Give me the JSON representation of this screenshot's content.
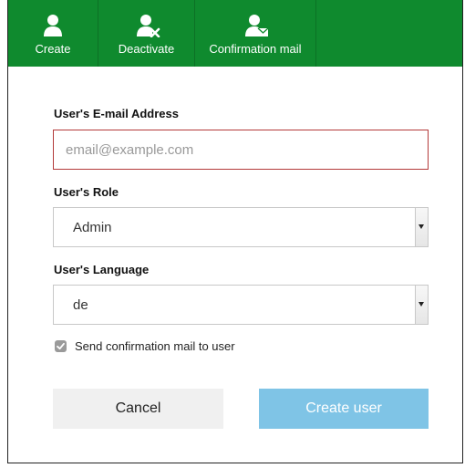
{
  "toolbar": {
    "background": "#0f8a2e",
    "items": [
      {
        "label": "Create",
        "icon": "user-icon"
      },
      {
        "label": "Deactivate",
        "icon": "user-deactivate-icon"
      },
      {
        "label": "Confirmation mail",
        "icon": "user-mail-icon"
      }
    ]
  },
  "form": {
    "email": {
      "label": "User's E-mail Address",
      "placeholder": "email@example.com",
      "value": "",
      "border_color": "#b33a3a"
    },
    "role": {
      "label": "User's Role",
      "selected": "Admin"
    },
    "language": {
      "label": "User's Language",
      "selected": "de"
    },
    "send_mail": {
      "label": "Send confirmation mail to user",
      "checked": true
    }
  },
  "actions": {
    "cancel_label": "Cancel",
    "create_label": "Create user",
    "create_color": "#7fc4e6"
  }
}
